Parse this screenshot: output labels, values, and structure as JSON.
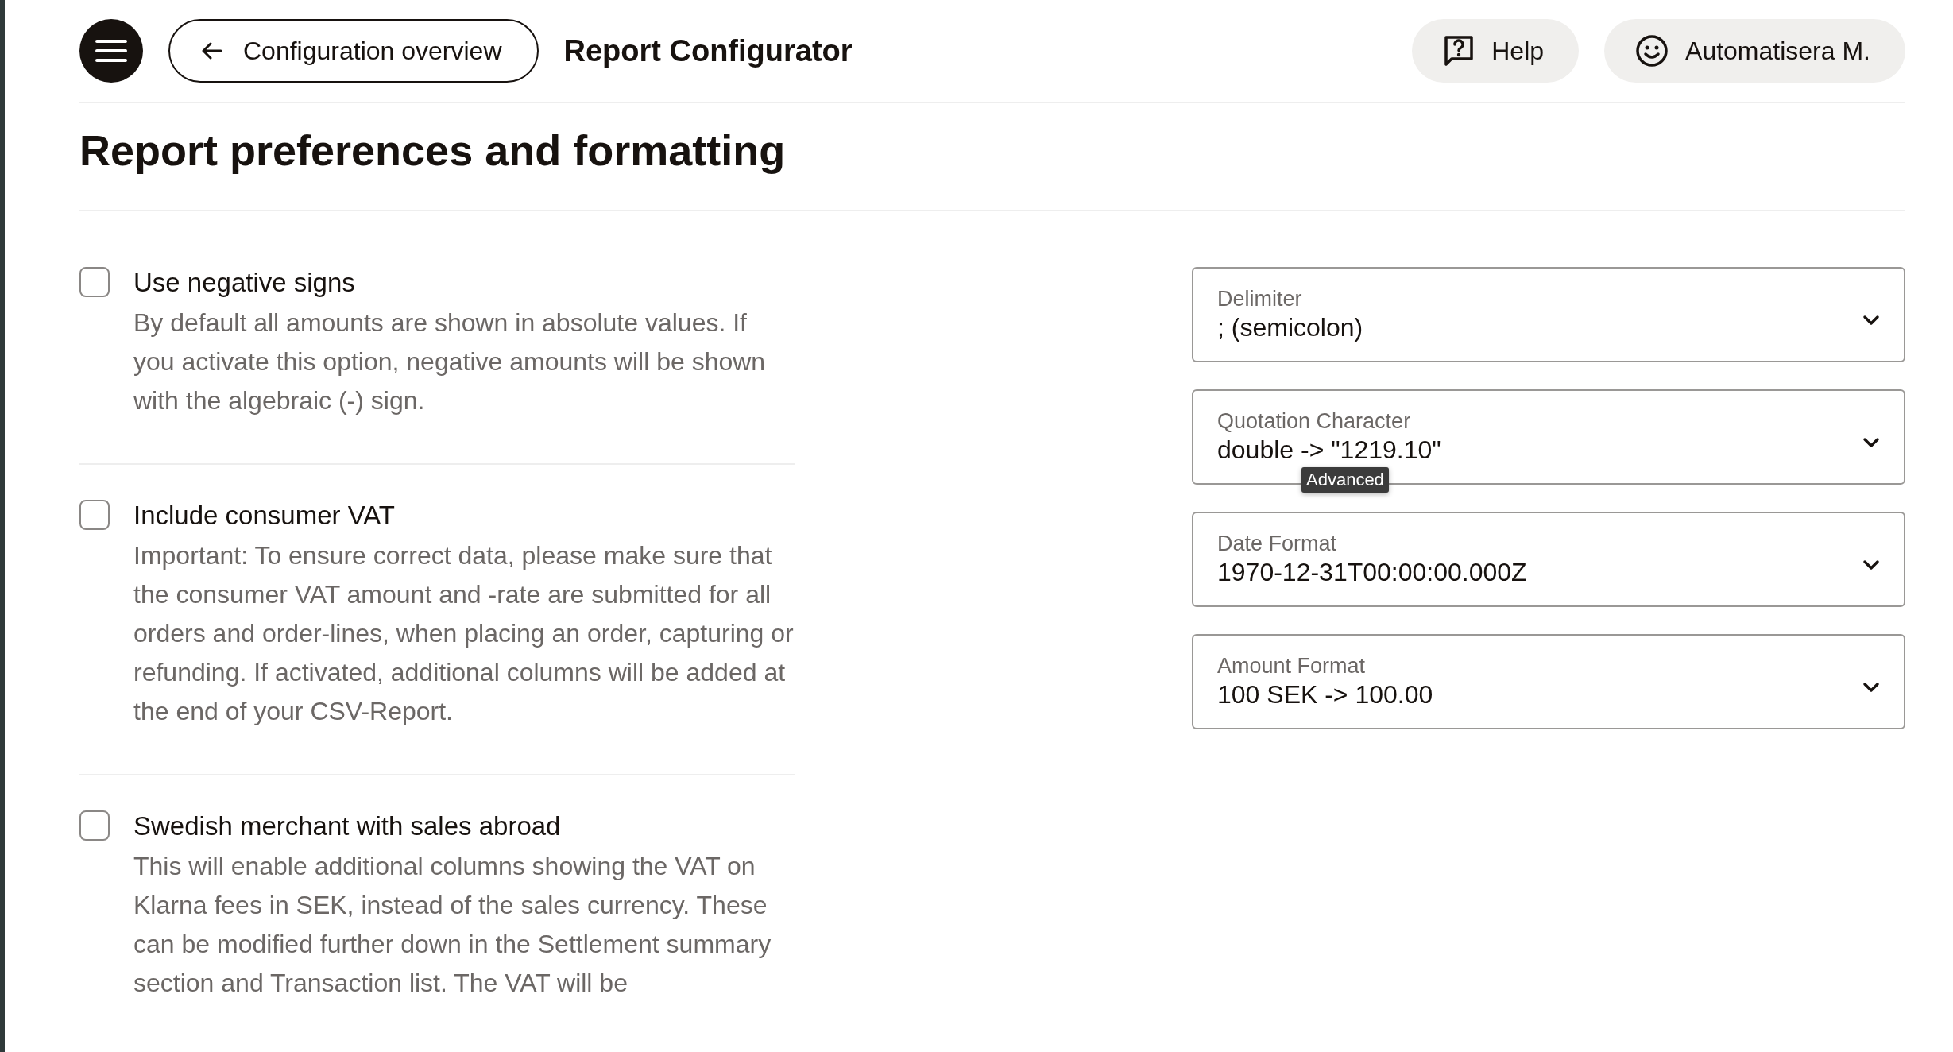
{
  "header": {
    "back_button": "Configuration overview",
    "title": "Report Configurator",
    "help_button": "Help",
    "user_button": "Automatisera M."
  },
  "page_title": "Report preferences and formatting",
  "options": [
    {
      "label": "Use negative signs",
      "checked": false,
      "description": "By default all amounts are shown in absolute values. If you activate this option, negative amounts will be shown with the algebraic (-) sign."
    },
    {
      "label": "Include consumer VAT",
      "checked": false,
      "description": "Important: To ensure correct data, please make sure that the consumer VAT amount and -rate are submitted for all orders and order-lines, when placing an order, capturing or refunding. If activated, additional columns will be added at the end of your CSV-Report."
    },
    {
      "label": "Swedish merchant with sales abroad",
      "checked": false,
      "description": "This will enable additional columns showing the VAT on Klarna fees in SEK, instead of the sales currency. These can be modified further down in the Settlement summary section and Transaction list. The VAT will be"
    }
  ],
  "selects": [
    {
      "label": "Delimiter",
      "value": "; (semicolon)"
    },
    {
      "label": "Quotation Character",
      "value": "double -> \"1219.10\"",
      "tooltip": "Advanced"
    },
    {
      "label": "Date Format",
      "value": "1970-12-31T00:00:00.000Z"
    },
    {
      "label": "Amount Format",
      "value": "100 SEK -> 100.00"
    }
  ]
}
